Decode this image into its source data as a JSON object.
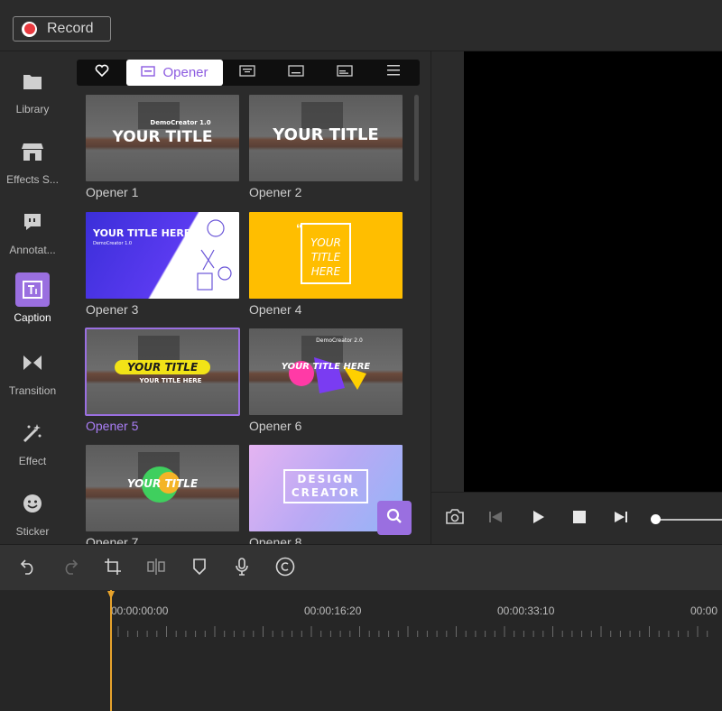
{
  "topbar": {
    "record_label": "Record"
  },
  "rail": [
    {
      "label": "Library",
      "icon": "folder-icon"
    },
    {
      "label": "Effects S...",
      "icon": "store-icon"
    },
    {
      "label": "Annotat...",
      "icon": "speech-bubble-icon"
    },
    {
      "label": "Caption",
      "icon": "caption-icon",
      "active": true
    },
    {
      "label": "Transition",
      "icon": "transition-icon"
    },
    {
      "label": "Effect",
      "icon": "magic-wand-icon"
    },
    {
      "label": "Sticker",
      "icon": "smiley-icon"
    }
  ],
  "tabs": {
    "opener_label": "Opener"
  },
  "cards": [
    {
      "title": "Opener 1",
      "thumb_text": "YOUR TITLE",
      "thumb_sub": "DemoCreator 1.0"
    },
    {
      "title": "Opener 2",
      "thumb_text": "YOUR TITLE"
    },
    {
      "title": "Opener 3",
      "thumb_text": "YOUR TITLE HERE",
      "thumb_sub": "DemoCreator 1.0"
    },
    {
      "title": "Opener 4",
      "thumb_text": "YOUR TITLE HERE"
    },
    {
      "title": "Opener 5",
      "thumb_text": "YOUR TITLE",
      "thumb_sub": "YOUR TITLE HERE",
      "selected": true
    },
    {
      "title": "Opener 6",
      "thumb_text": "YOUR TITLE HERE",
      "thumb_sub": "DemoCreator 2.0"
    },
    {
      "title": "Opener 7",
      "thumb_text": "YOUR TITLE"
    },
    {
      "title": "Opener 8",
      "thumb_text": "DESIGN",
      "thumb_sub": "CREATOR"
    }
  ],
  "timeline": {
    "timecodes": [
      "00:00:00:00",
      "00:00:16:20",
      "00:00:33:10",
      "00:00"
    ]
  },
  "colors": {
    "accent": "#9a6fe0",
    "record": "#e8393f",
    "playhead": "#e7a32c"
  }
}
